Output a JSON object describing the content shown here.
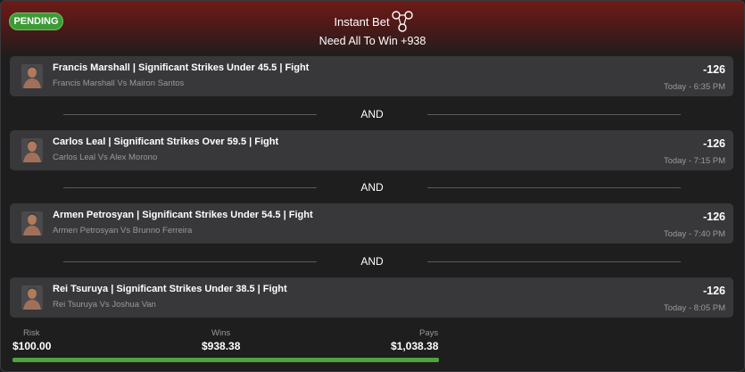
{
  "status_badge": "PENDING",
  "header": {
    "title": "Instant Bet",
    "subtitle": "Need All To Win +938",
    "icon": "parlay-icon"
  },
  "separator_label": "AND",
  "legs": [
    {
      "title": "Francis Marshall | Significant Strikes Under 45.5 | Fight",
      "matchup": "Francis Marshall Vs Mairon Santos",
      "odds": "-126",
      "time": "Today - 6:35 PM"
    },
    {
      "title": "Carlos Leal | Significant Strikes Over 59.5 | Fight",
      "matchup": "Carlos Leal Vs Alex Morono",
      "odds": "-126",
      "time": "Today - 7:15 PM"
    },
    {
      "title": "Armen Petrosyan | Significant Strikes Under 54.5 | Fight",
      "matchup": "Armen Petrosyan Vs Brunno Ferreira",
      "odds": "-126",
      "time": "Today - 7:40 PM"
    },
    {
      "title": "Rei Tsuruya | Significant Strikes Under 38.5 | Fight",
      "matchup": "Rei Tsuruya Vs Joshua Van",
      "odds": "-126",
      "time": "Today - 8:05 PM"
    }
  ],
  "footer": {
    "risk_label": "Risk",
    "risk_value": "$100.00",
    "wins_label": "Wins",
    "wins_value": "$938.38",
    "pays_label": "Pays",
    "pays_value": "$1,038.38",
    "progress_percent": 100
  },
  "colors": {
    "accent_green": "#4fa33f",
    "header_red": "#6e1b17",
    "leg_bg": "#38383a"
  }
}
